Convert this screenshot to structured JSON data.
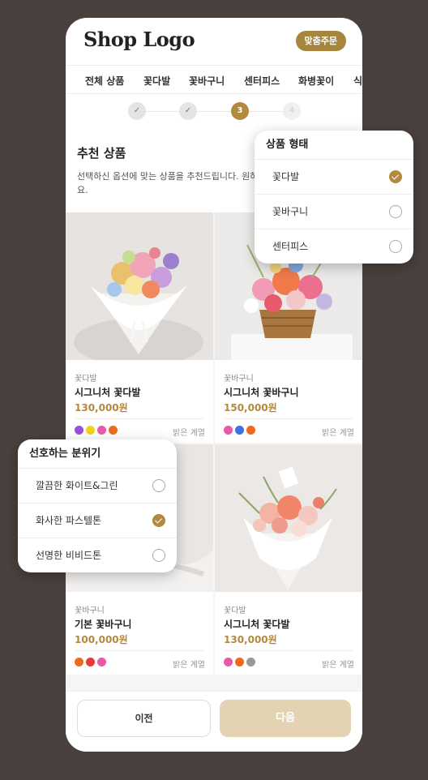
{
  "header": {
    "logo": "Shop Logo",
    "custom_order_label": "맞춤주문"
  },
  "categories": [
    "전체 상품",
    "꽃다발",
    "꽃바구니",
    "센터피스",
    "화병꽃이",
    "식"
  ],
  "steps": [
    {
      "label": "✓",
      "state": "done"
    },
    {
      "label": "✓",
      "state": "done"
    },
    {
      "label": "3",
      "state": "active"
    },
    {
      "label": "4",
      "state": "todo"
    }
  ],
  "recommend": {
    "title": "추천 상품",
    "description": "선택하신 옵션에 맞는 상품을 추천드립니다. 원하시는 상품을 선택해주세요."
  },
  "products": [
    {
      "category": "꽃다발",
      "name": "시그니처 꽃다발",
      "price": "130,000원",
      "tone": "밝은 계열",
      "colors": [
        "#9b4fd6",
        "#f2d21b",
        "#e85aa5",
        "#ee6a1f"
      ]
    },
    {
      "category": "꽃바구니",
      "name": "시그니처 꽃바구니",
      "price": "150,000원",
      "tone": "밝은 계열",
      "colors": [
        "#e85aa5",
        "#3f72e0",
        "#ee6a1f"
      ]
    },
    {
      "category": "꽃바구니",
      "name": "기본 꽃바구니",
      "price": "100,000원",
      "tone": "밝은 계열",
      "colors": [
        "#ee6a1f",
        "#e8383a",
        "#e85aa5"
      ]
    },
    {
      "category": "꽃다발",
      "name": "시그니처 꽃다발",
      "price": "130,000원",
      "tone": "밝은 계열",
      "colors": [
        "#e85aa5",
        "#ee6a1f",
        "#999999"
      ]
    }
  ],
  "product_type_popover": {
    "title": "상품 형태",
    "options": [
      {
        "label": "꽃다발",
        "checked": true
      },
      {
        "label": "꽃바구니",
        "checked": false
      },
      {
        "label": "센터피스",
        "checked": false
      }
    ]
  },
  "mood_popover": {
    "title": "선호하는 분위기",
    "options": [
      {
        "label": "깔끔한 화이트&그린",
        "checked": false
      },
      {
        "label": "화사한 파스텔톤",
        "checked": true
      },
      {
        "label": "선명한 비비드톤",
        "checked": false
      }
    ]
  },
  "footer": {
    "prev_label": "이전",
    "next_label": "다음"
  },
  "colors": {
    "accent": "#b3893e",
    "background": "#4a403d",
    "next_button": "#e3d3b3"
  }
}
